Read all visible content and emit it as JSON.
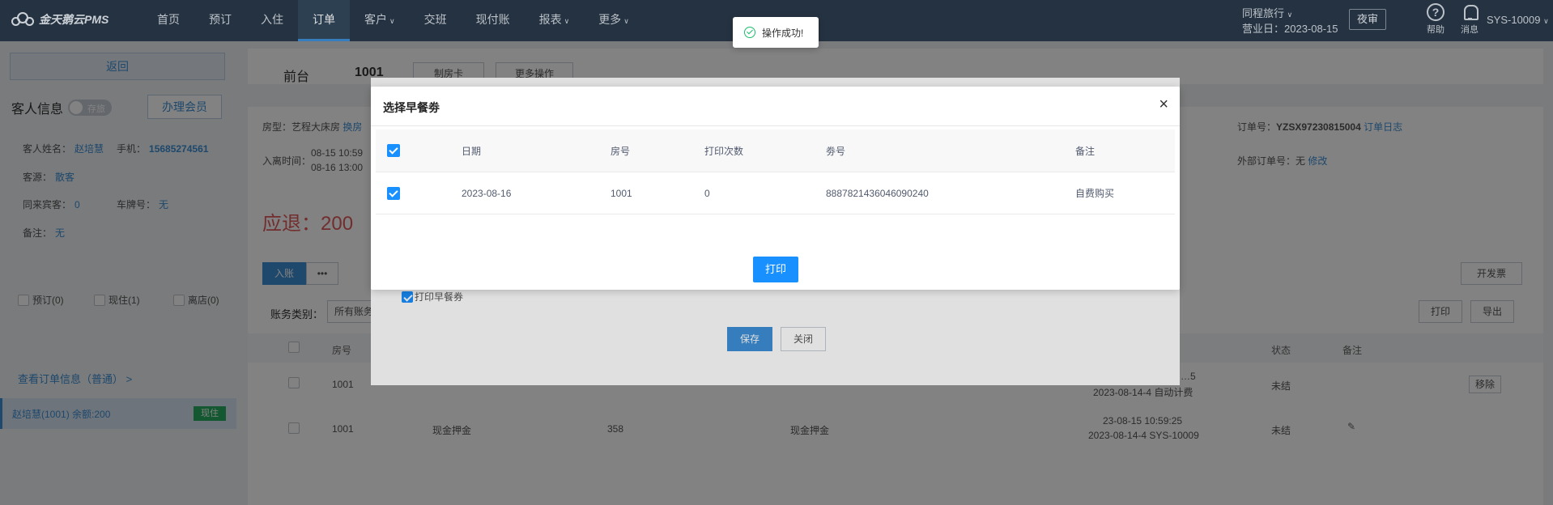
{
  "app": {
    "logo": "金天鹅云PMS"
  },
  "nav": {
    "items": [
      {
        "label": "首页"
      },
      {
        "label": "预订"
      },
      {
        "label": "入住"
      },
      {
        "label": "订单"
      },
      {
        "label": "客户"
      },
      {
        "label": "交班"
      },
      {
        "label": "现付账"
      },
      {
        "label": "报表"
      },
      {
        "label": "更多"
      }
    ]
  },
  "topright": {
    "hotel": "同程旅行",
    "business_day": "营业日：2023-08-15",
    "night_audit": "夜审",
    "help": "帮助",
    "messages": "消息",
    "user": "SYS-10009"
  },
  "left": {
    "back": "返回",
    "guest_title": "客人信息",
    "toggle": "存旅",
    "member_btn": "办理会员",
    "guest_name_label": "客人姓名：",
    "guest_name": "赵培慧",
    "phone_label": "手机：",
    "phone": "15685274561",
    "source_label": "客源：",
    "source": "散客",
    "companions_label": "同来宾客：",
    "companions": "0",
    "plate_label": "车牌号：",
    "plate": "无",
    "note_label": "备注：",
    "note": "无",
    "filters": [
      "预订(0)",
      "现住(1)",
      "离店(0)"
    ],
    "order_link": "查看订单信息（普通） >",
    "room_item": "赵培慧(1001)  余额:200",
    "room_badge": "现住"
  },
  "main": {
    "front_desk": "前台",
    "room_no": "1001",
    "make_card": "制房卡",
    "more_ops": "更多操作",
    "room_type_label": "房型：",
    "room_type": "艺程大床房",
    "change_room": "换房",
    "checkin_label": "入离时间：",
    "checkin_time": "08-15 10:59",
    "checkout_time": "08-16 13:00",
    "order_no_label": "订单号：",
    "order_no": "YZSX97230815004",
    "order_log": "订单日志",
    "ext_order_label": "外部订单号：",
    "ext_order": "无",
    "ext_edit": "修改",
    "refund": "应退：200",
    "post_btn": "入账",
    "more_btn": "•••",
    "invoice_btn": "开发票",
    "print_btn": "打印",
    "export_btn": "导出",
    "acct_type_label": "账务类别：",
    "acct_type_value": "所有账务",
    "table_headers": [
      "房号",
      "状态",
      "备注"
    ],
    "rows": [
      {
        "room": "1001",
        "status": "未结",
        "op": "移除",
        "time": "…5",
        "sub": "2023-08-14-4 自动计费"
      },
      {
        "room": "1001",
        "item": "现金押金",
        "amount": "358",
        "desc": "现金押金",
        "time": "23-08-15 10:59:25",
        "sub": "2023-08-14-4 SYS-10009",
        "status": "未结"
      }
    ]
  },
  "back_dialog": {
    "print_breakfast": "打印早餐券",
    "save": "保存",
    "close": "关闭"
  },
  "modal": {
    "title": "选择早餐劵",
    "close": "×",
    "headers": [
      "日期",
      "房号",
      "打印次数",
      "劵号",
      "备注"
    ],
    "rows": [
      {
        "date": "2023-08-16",
        "room": "1001",
        "count": "0",
        "coupon": "8887821436046090240",
        "note": "自费购买"
      }
    ],
    "print": "打印"
  },
  "toast": {
    "text": "操作成功!"
  }
}
